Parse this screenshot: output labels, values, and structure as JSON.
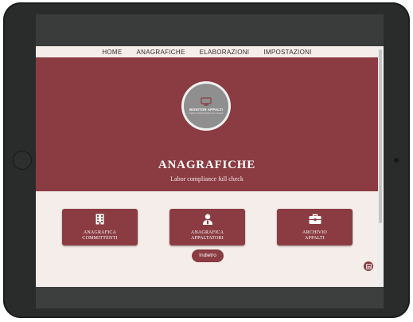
{
  "nav": {
    "items": [
      {
        "label": "HOME"
      },
      {
        "label": "ANAGRAFICHE"
      },
      {
        "label": "ELABORAZIONI"
      },
      {
        "label": "IMPOSTAZIONI"
      }
    ]
  },
  "logo": {
    "title": "MONITOR APPALTI",
    "subtitle": "LABOR COMPLIANCE FULL CHECK"
  },
  "hero": {
    "title": "ANAGRAFICHE",
    "subtitle": "Labor compliance full check"
  },
  "cards": [
    {
      "line1": "ANAGRAFICA",
      "line2": "COMMITTENTI",
      "icon": "building-icon"
    },
    {
      "line1": "ANAGRAFICA",
      "line2": "APPALTATORI",
      "icon": "person-tie-icon"
    },
    {
      "line1": "ARCHIVIO",
      "line2": "APPALTI",
      "icon": "briefcase-icon"
    }
  ],
  "back_button": {
    "label": "Indietro"
  },
  "corner_button": {
    "icon": "linkedin-icon"
  },
  "colors": {
    "brand": "#8a3c42",
    "page_background": "#f5ede9",
    "device_frame": "#2a2c2c"
  }
}
